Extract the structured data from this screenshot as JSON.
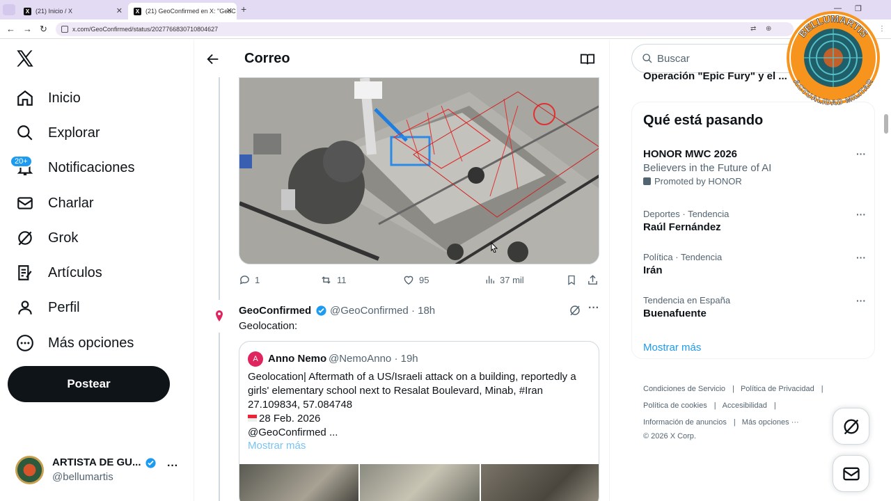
{
  "browser": {
    "tabs": [
      {
        "label": "(21) Inicio / X",
        "favicon": "x-logo-icon"
      },
      {
        "label": "(21) GeoConfirmed en X: \"GeoC",
        "favicon": "x-logo-icon",
        "active": true
      }
    ],
    "url": "x.com/GeoConfirmed/status/2027766830710804627"
  },
  "sidebar": {
    "logo": "X",
    "items": [
      {
        "label": "Inicio",
        "icon": "home-icon"
      },
      {
        "label": "Explorar",
        "icon": "search-icon"
      },
      {
        "label": "Notificaciones",
        "icon": "bell-icon",
        "badge": "20+"
      },
      {
        "label": "Charlar",
        "icon": "mail-icon"
      },
      {
        "label": "Grok",
        "icon": "grok-icon"
      },
      {
        "label": "Artículos",
        "icon": "articles-icon"
      },
      {
        "label": "Perfil",
        "icon": "person-icon"
      },
      {
        "label": "Más opciones",
        "icon": "more-circle-icon"
      }
    ],
    "post_button": "Postear",
    "account": {
      "name": "ARTISTA DE GU...",
      "handle": "@bellumartis"
    }
  },
  "main": {
    "header_title": "Correo",
    "tweet1_actions": {
      "replies": "1",
      "reposts": "11",
      "likes": "95",
      "views": "37 mil"
    },
    "tweet2": {
      "name": "GeoConfirmed",
      "handle_time": "@GeoConfirmed · 18h",
      "text": "Geolocation:",
      "quote": {
        "avatar_letter": "A",
        "name": "Anno Nemo",
        "handle_time": "@NemoAnno · 19h",
        "lines": [
          "Geolocation| Aftermath of a US/Israeli attack on a building, reportedly a",
          "girls' elementary school next to Resalat Boulevard, Minab, #Iran",
          "27.109834, 57.084748",
          "28 Feb. 2026",
          "@GeoConfirmed ..."
        ],
        "show_more": "Mostrar más"
      }
    }
  },
  "right": {
    "search_placeholder": "Buscar",
    "peek_text": "Operación \"Epic Fury\" y el ...",
    "trends_title": "Qué está pasando",
    "trends": [
      {
        "meta": "",
        "name": "HONOR MWC 2026",
        "sub": "Believers in the Future of AI",
        "promo": "Promoted by HONOR"
      },
      {
        "meta": "Deportes · Tendencia",
        "name": "Raúl Fernández"
      },
      {
        "meta": "Política · Tendencia",
        "name": "Irán"
      },
      {
        "meta": "Tendencia en España",
        "name": "Buenafuente"
      }
    ],
    "show_more": "Mostrar más",
    "footer": [
      "Condiciones de Servicio",
      "Política de Privacidad",
      "Política de cookies",
      "Accesibilidad",
      "Información de anuncios",
      "Más opciones ···",
      "© 2026 X Corp."
    ]
  },
  "watermark": {
    "top_text": "BELLUMARTIS",
    "bottom_text": "ACTUALIDAD MILITAR"
  }
}
